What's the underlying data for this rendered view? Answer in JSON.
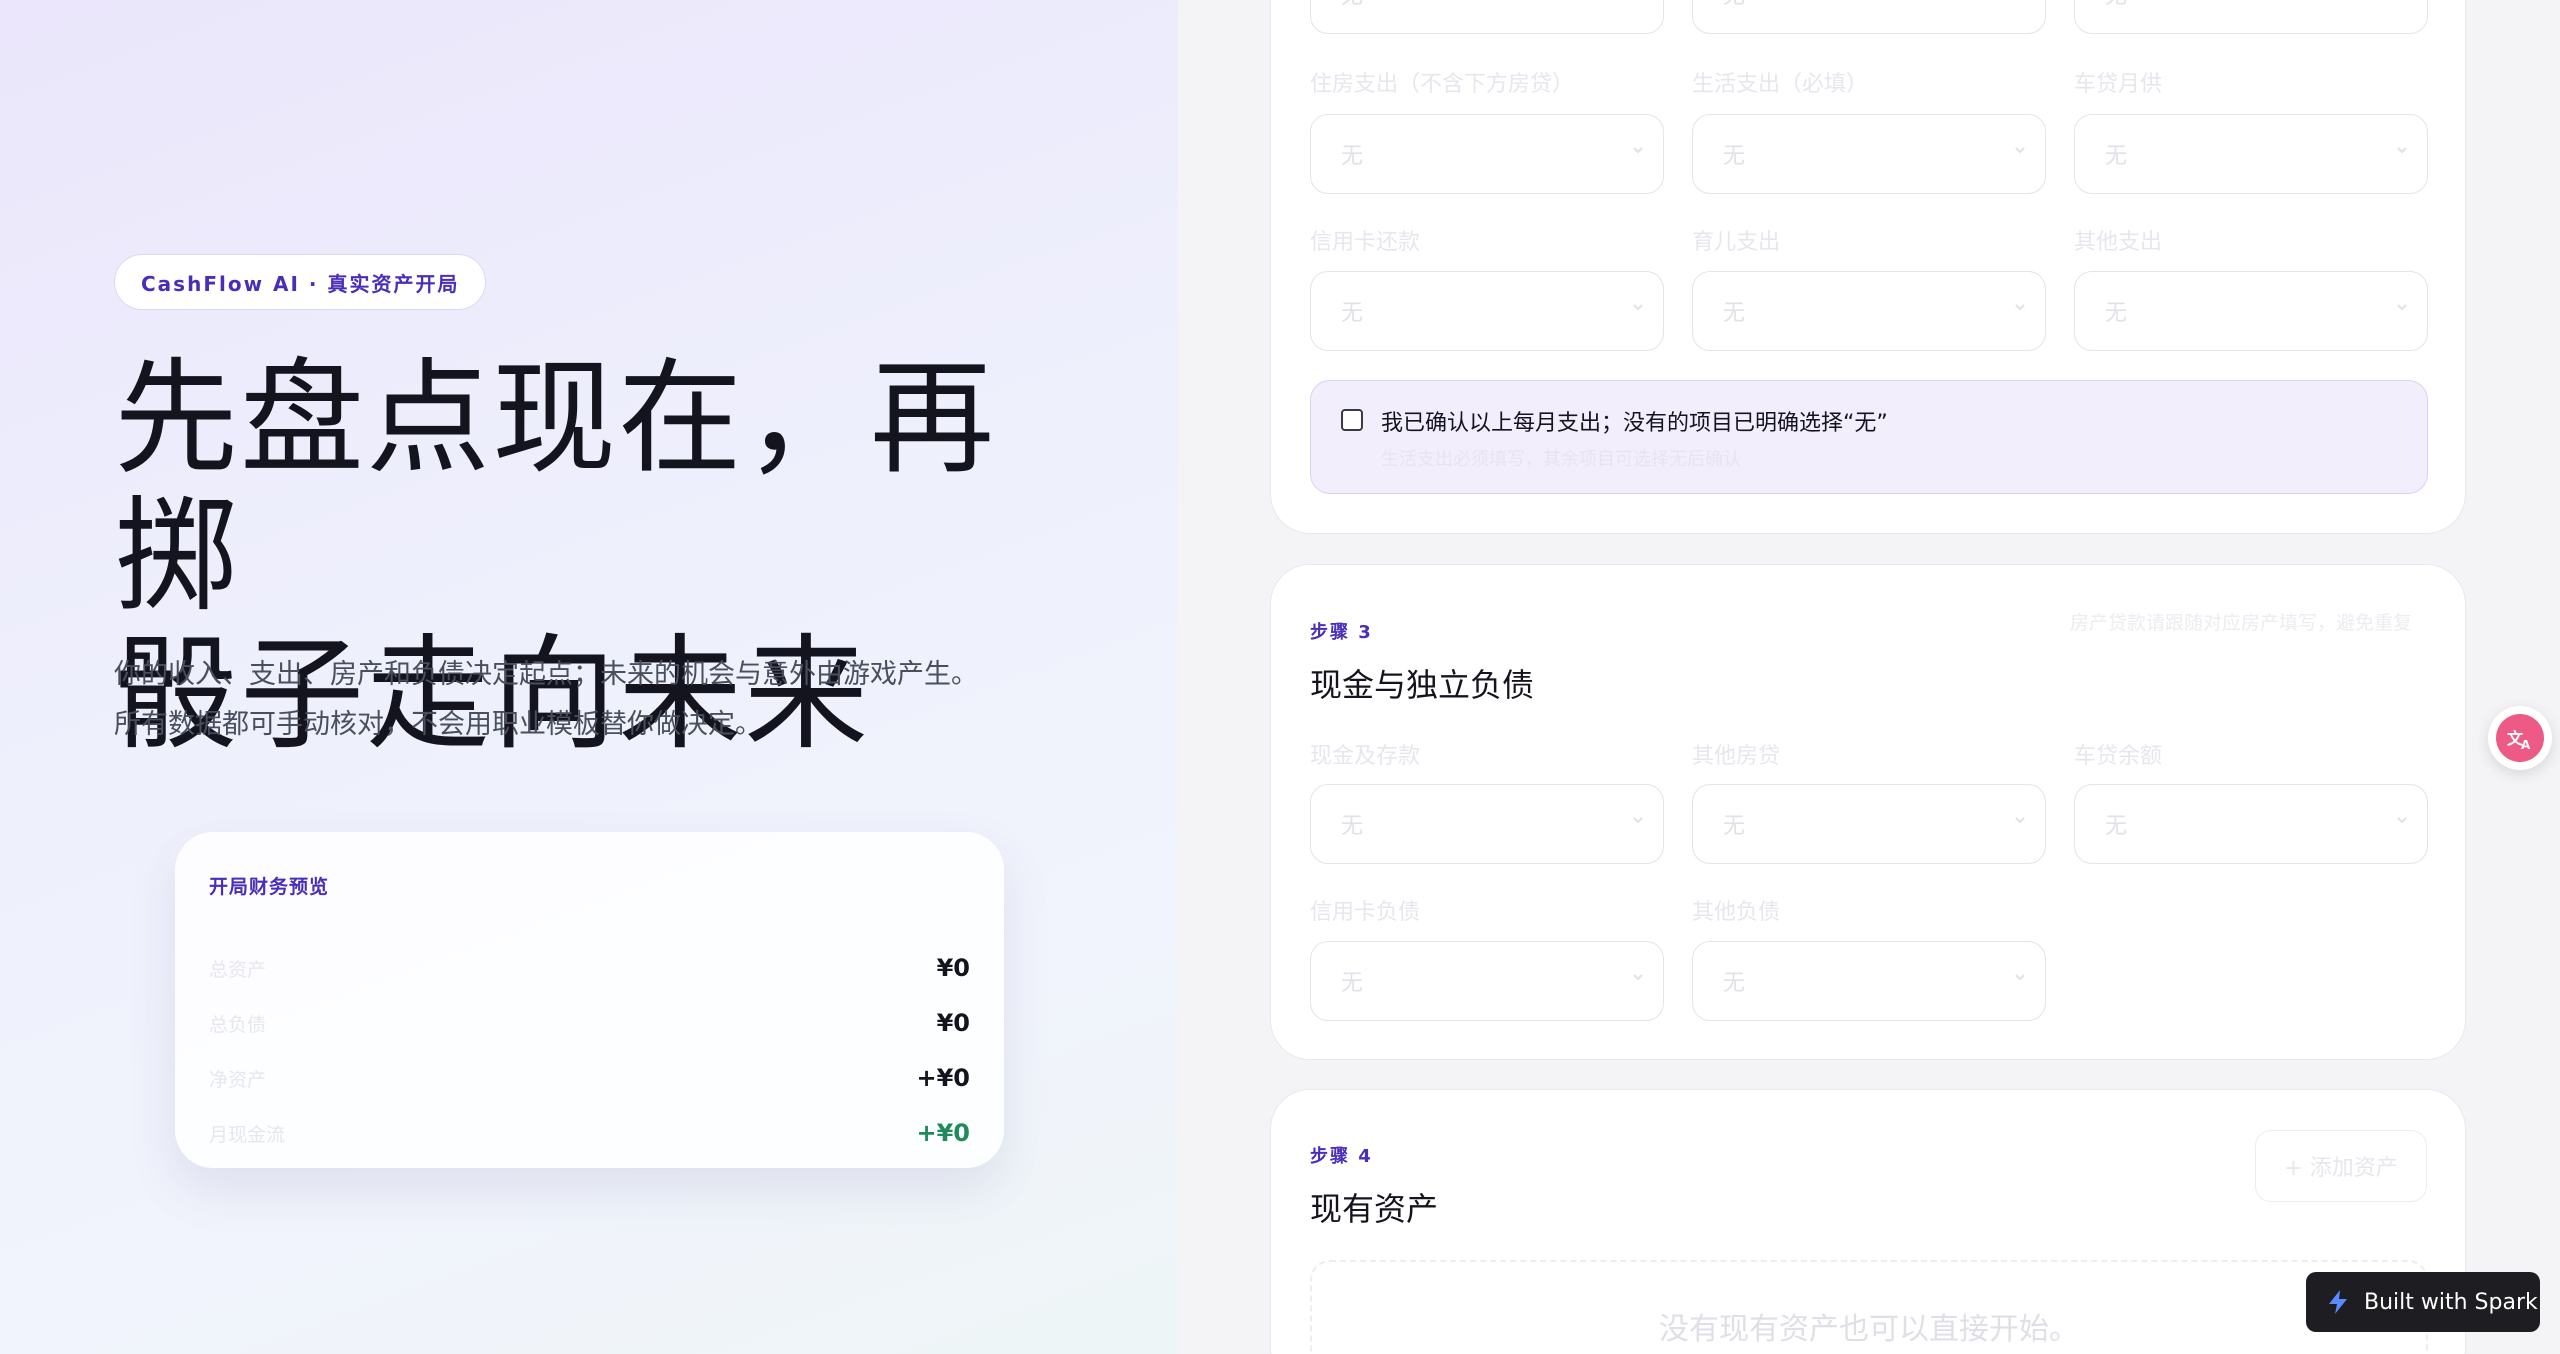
{
  "hero": {
    "badge": "CashFlow AI · 真实资产开局",
    "title_line1": "先盘点现在，再掷",
    "title_line2": "骰子走向未来",
    "desc_line1": "你的收入、支出、房产和负债决定起点；未来的机会与意外由游戏产生。",
    "desc_line2": "所有数据都可手动核对，不会用职业模板替你做决定。"
  },
  "preview": {
    "title": "开局财务预览",
    "rows": [
      {
        "label": "总资产",
        "value": "¥0"
      },
      {
        "label": "总负债",
        "value": "¥0"
      },
      {
        "label": "净资产",
        "value": "+¥0"
      },
      {
        "label": "月现金流",
        "value": "+¥0"
      }
    ]
  },
  "expenses": {
    "top_values": [
      "无",
      "无",
      "无"
    ],
    "fields": [
      {
        "label": "住房支出（不含下方房贷）",
        "value": "无"
      },
      {
        "label": "生活支出（必填）",
        "value": "无"
      },
      {
        "label": "车贷月供",
        "value": "无"
      },
      {
        "label": "信用卡还款",
        "value": "无"
      },
      {
        "label": "育儿支出",
        "value": "无"
      },
      {
        "label": "其他支出",
        "value": "无"
      }
    ],
    "confirm_label": "我已确认以上每月支出；没有的项目已明确选择“无”",
    "confirm_sub": "生活支出必须填写，其余项目可选择无后确认"
  },
  "step3": {
    "tag": "步骤 3",
    "title": "现金与独立负债",
    "hint": "房产贷款请跟随对应房产填写，避免重复",
    "fields": [
      {
        "label": "现金及存款",
        "value": "无"
      },
      {
        "label": "其他房贷",
        "value": "无"
      },
      {
        "label": "车贷余额",
        "value": "无"
      },
      {
        "label": "信用卡负债",
        "value": "无"
      },
      {
        "label": "其他负债",
        "value": "无"
      }
    ]
  },
  "step4": {
    "tag": "步骤 4",
    "title": "现有资产",
    "add_button": "+ 添加资产",
    "empty_text": "没有现有资产也可以直接开始。"
  },
  "widgets": {
    "translate_icon": "translate-icon",
    "spark_label": "Built with Spark"
  },
  "colors": {
    "accent": "#4a2db8",
    "positive": "#1f8a5a",
    "confirm_bg": "#f3eefb"
  }
}
